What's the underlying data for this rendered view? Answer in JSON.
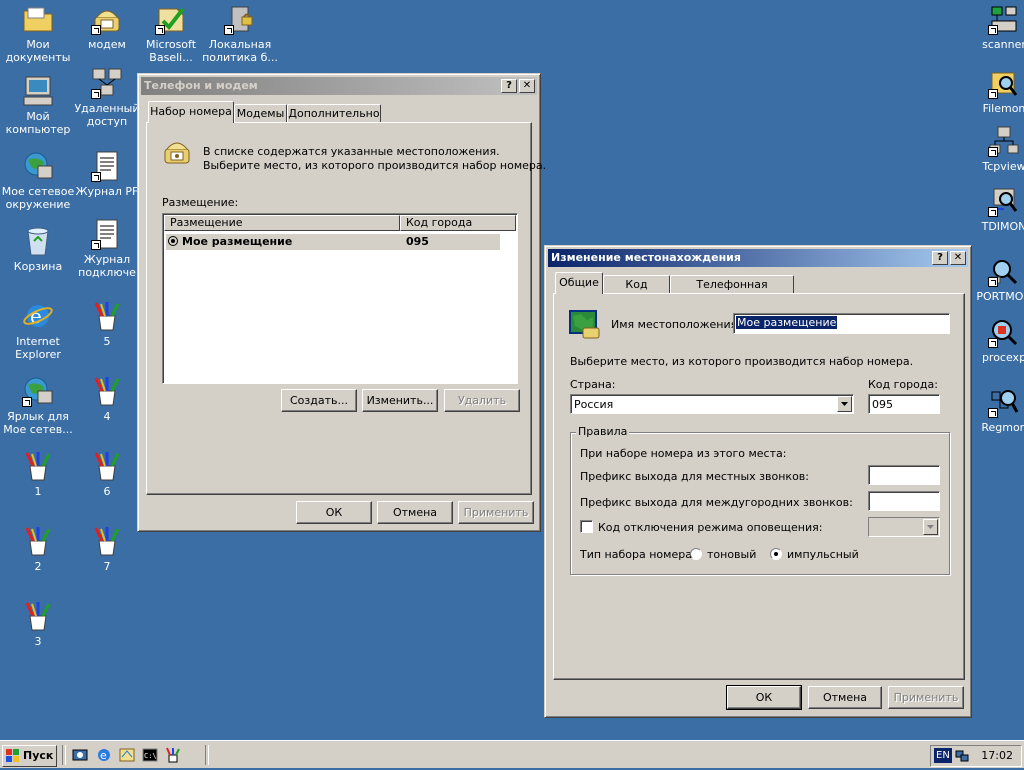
{
  "desktop": {
    "icons_left": [
      {
        "label": "Мои\nдокументы",
        "icon": "folder-documents-icon"
      },
      {
        "label": "модем",
        "icon": "modem-phone-icon"
      },
      {
        "label": "Microsoft\nBaseli...",
        "icon": "baseline-analyzer-icon"
      },
      {
        "label": "Локальная\nполитика б...",
        "icon": "local-policy-icon"
      },
      {
        "label": "Мой\nкомпьютер",
        "icon": "my-computer-icon"
      },
      {
        "label": "Удаленный\nдоступ",
        "icon": "remote-access-icon"
      },
      {
        "label": "Мое сетевое\nокружение",
        "icon": "network-neighborhood-icon"
      },
      {
        "label": "Журнал PF",
        "icon": "log-document-icon"
      },
      {
        "label": "Корзина",
        "icon": "recycle-bin-icon"
      },
      {
        "label": "Журнал\nподключе",
        "icon": "log-document-icon"
      },
      {
        "label": "Internet\nExplorer",
        "icon": "internet-explorer-icon"
      },
      {
        "label": "5",
        "icon": "paint-brushes-icon"
      },
      {
        "label": "Ярлык для\nМое сетев...",
        "icon": "network-shortcut-icon"
      },
      {
        "label": "4",
        "icon": "paint-brushes-icon"
      },
      {
        "label": "1",
        "icon": "paint-brushes-icon"
      },
      {
        "label": "6",
        "icon": "paint-brushes-icon"
      },
      {
        "label": "2",
        "icon": "paint-brushes-icon"
      },
      {
        "label": "7",
        "icon": "paint-brushes-icon"
      },
      {
        "label": "3",
        "icon": "paint-brushes-icon"
      }
    ],
    "icons_right": [
      {
        "label": "scanner",
        "icon": "scanner-icon"
      },
      {
        "label": "Filemon",
        "icon": "filemon-icon"
      },
      {
        "label": "Tcpview",
        "icon": "tcpview-icon"
      },
      {
        "label": "TDIMON",
        "icon": "tdimon-icon"
      },
      {
        "label": "PORTMON",
        "icon": "portmon-icon"
      },
      {
        "label": "procexp",
        "icon": "procexp-icon"
      },
      {
        "label": "Regmon",
        "icon": "regmon-icon"
      }
    ]
  },
  "phone_window": {
    "title": "Телефон и модем",
    "tabs": [
      "Набор номера",
      "Модемы",
      "Дополнительно"
    ],
    "info_line1": "В списке содержатся указанные местоположения.",
    "info_line2": "Выберите место, из которого производится набор номера.",
    "locations_label": "Размещение:",
    "columns": [
      "Размещение",
      "Код города"
    ],
    "rows": [
      {
        "location": "Мое размещение",
        "code": "095"
      }
    ],
    "btn_new": "Создать...",
    "btn_edit": "Изменить...",
    "btn_delete": "Удалить",
    "btn_ok": "ОК",
    "btn_cancel": "Отмена",
    "btn_apply": "Применить"
  },
  "location_window": {
    "title": "Изменение местонахождения",
    "tabs": [
      "Общие",
      "Код города",
      "Телефонная карточка"
    ],
    "name_label": "Имя местоположения:",
    "name_value": "Мое размещение",
    "choose_text": "Выберите место, из которого производится набор номера.",
    "country_label": "Страна:",
    "country_value": "Россия",
    "city_code_label": "Код города:",
    "city_code_value": "095",
    "rules_label": "Правила",
    "rules_intro": "При наборе номера из этого места:",
    "local_prefix_label": "Префикс выхода для местных звонков:",
    "long_prefix_label": "Префикс выхода для междугородних звонков:",
    "call_waiting_label": "Код отключения режима оповещения:",
    "dial_type_label": "Тип набора номера:",
    "tone_label": "тоновый",
    "pulse_label": "импульсный",
    "btn_ok": "ОК",
    "btn_cancel": "Отмена",
    "btn_apply": "Применить"
  },
  "taskbar": {
    "start_label": "Пуск",
    "lang": "EN",
    "clock": "17:02"
  },
  "colors": {
    "desktop": "#3a6ea5",
    "active_title": "#0a246a",
    "inactive_title": "#808080",
    "selection": "#0a246a"
  }
}
